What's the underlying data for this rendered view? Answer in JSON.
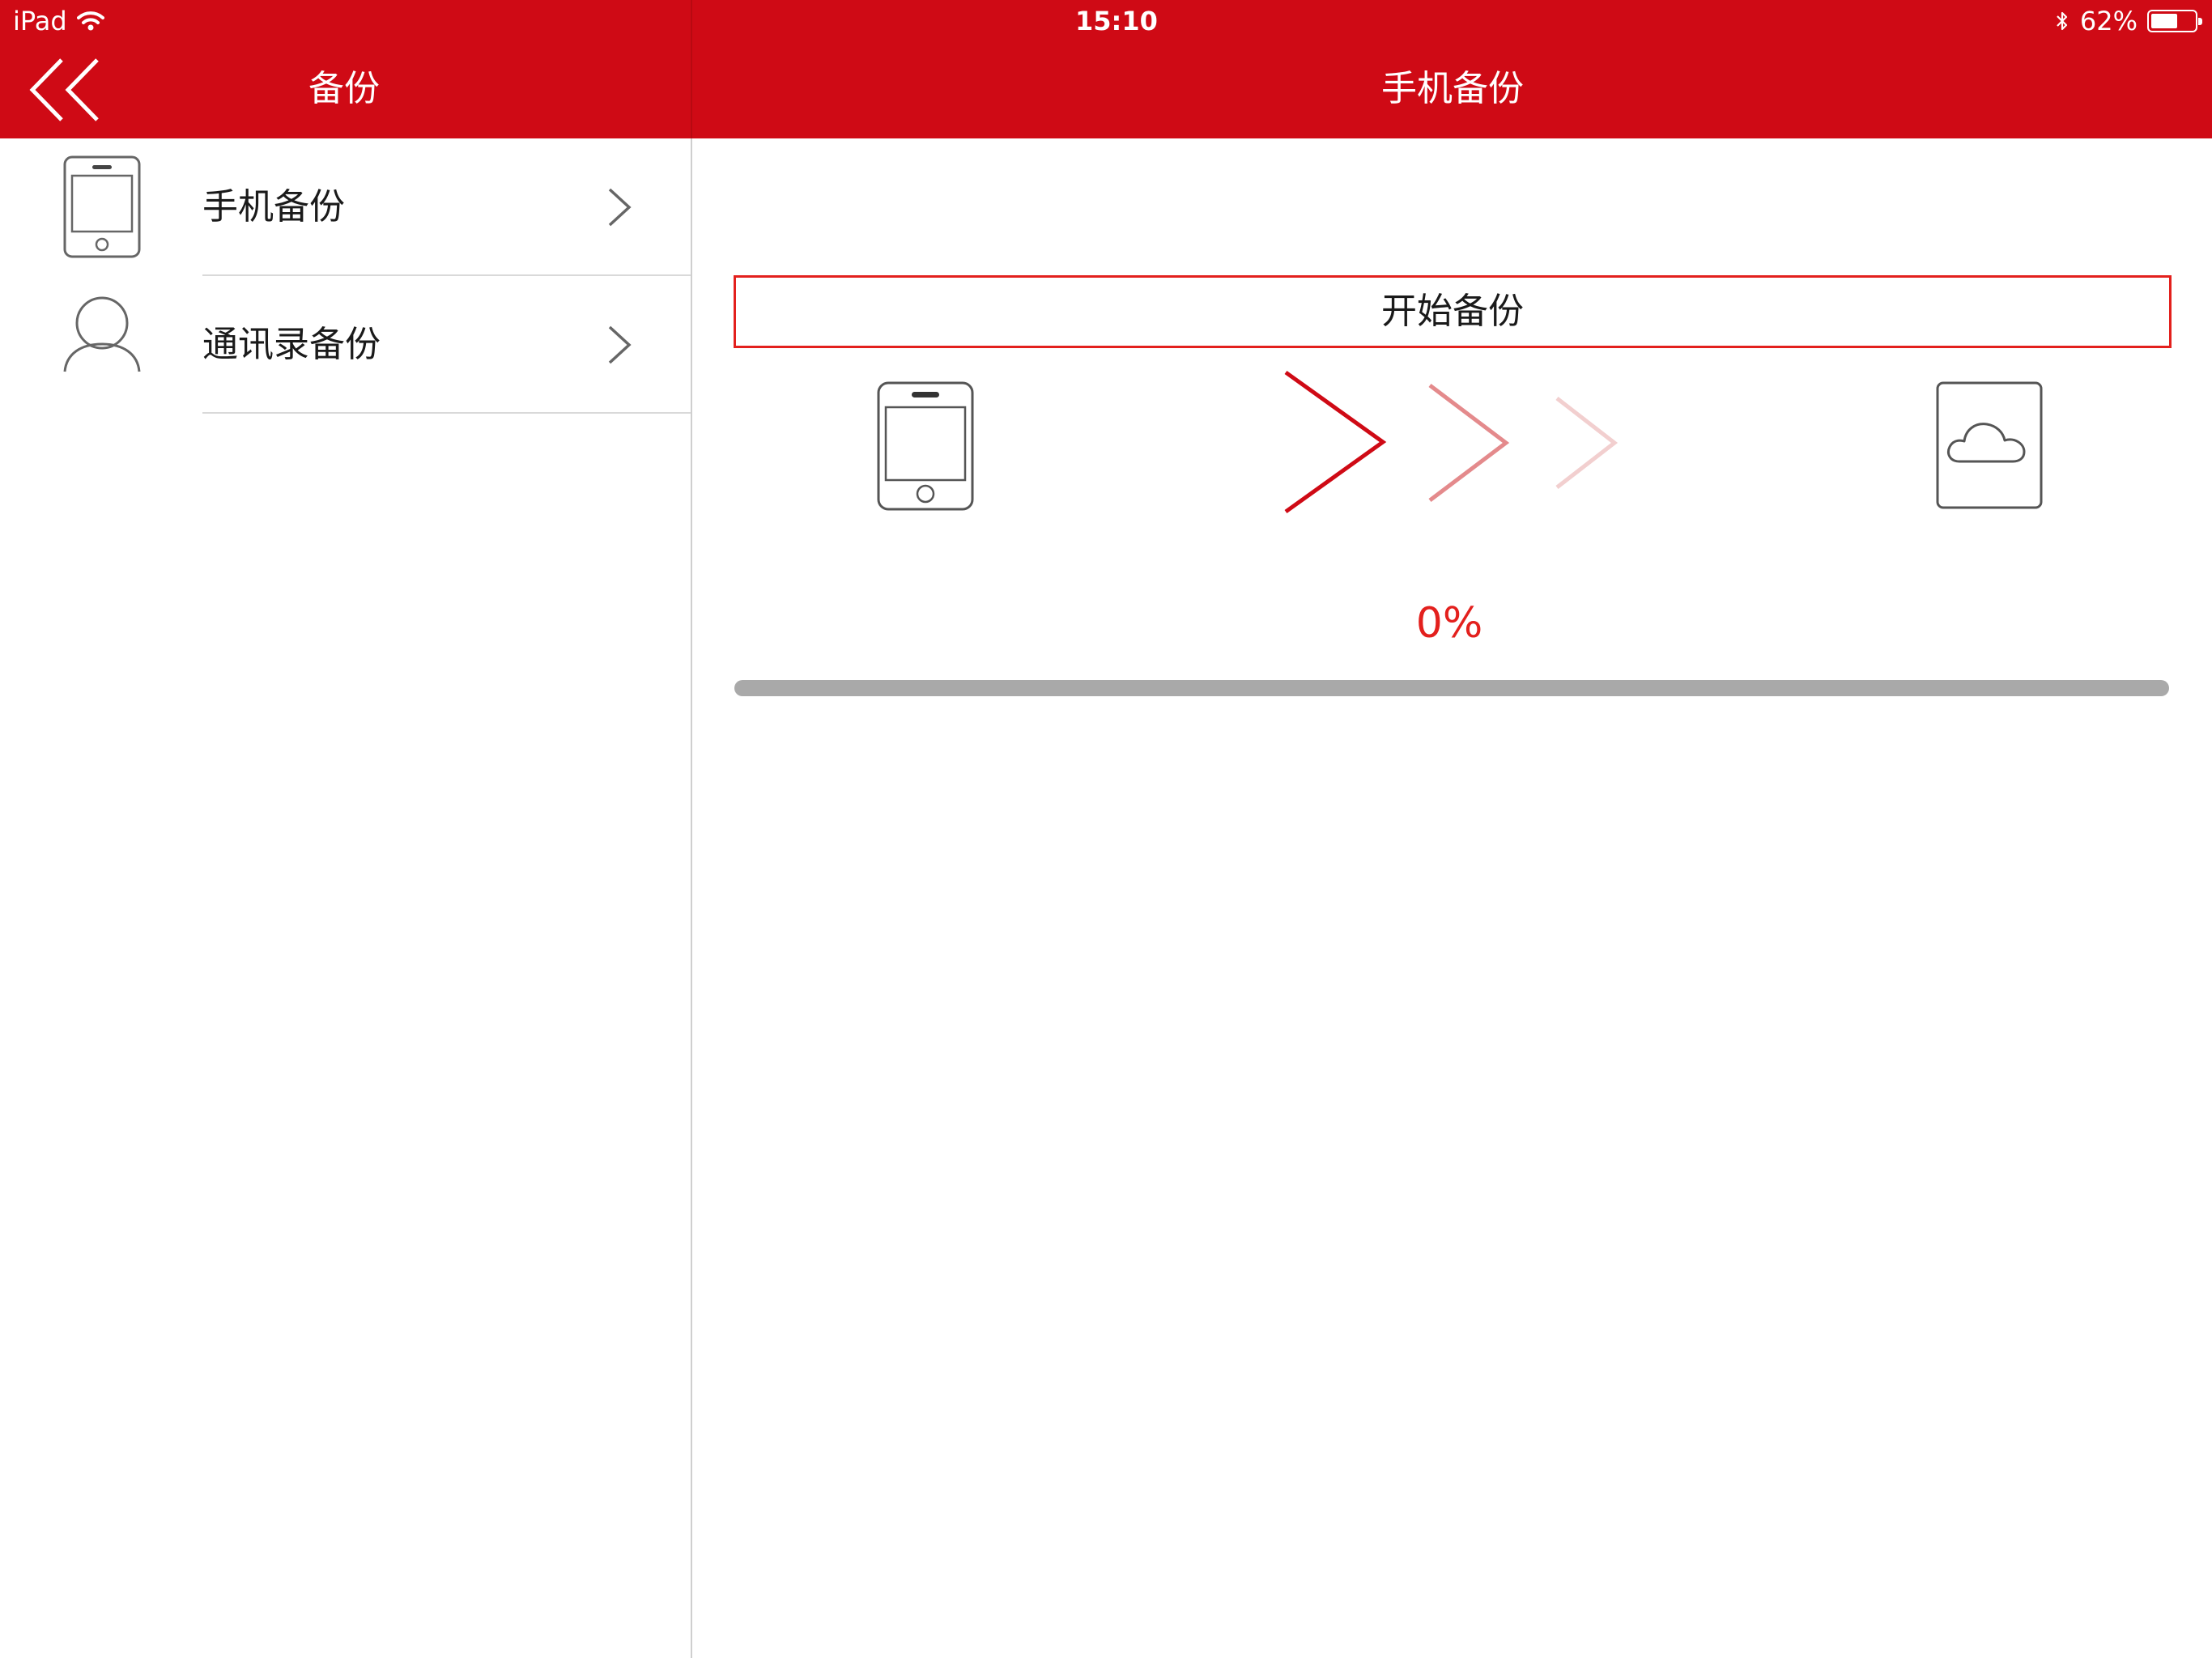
{
  "status_bar": {
    "device": "iPad",
    "time": "15:10",
    "battery_text": "62%",
    "battery_level": 0.62
  },
  "sidebar": {
    "title": "备份",
    "items": [
      {
        "label": "手机备份",
        "icon": "phone-icon"
      },
      {
        "label": "通讯录备份",
        "icon": "contact-person-icon"
      }
    ]
  },
  "main": {
    "title": "手机备份",
    "start_button_label": "开始备份",
    "progress_text": "0%",
    "progress_value": 0
  },
  "colors": {
    "brand_red": "#cf0a15",
    "accent_red": "#e3201d",
    "track_gray": "#a9a9a9"
  }
}
